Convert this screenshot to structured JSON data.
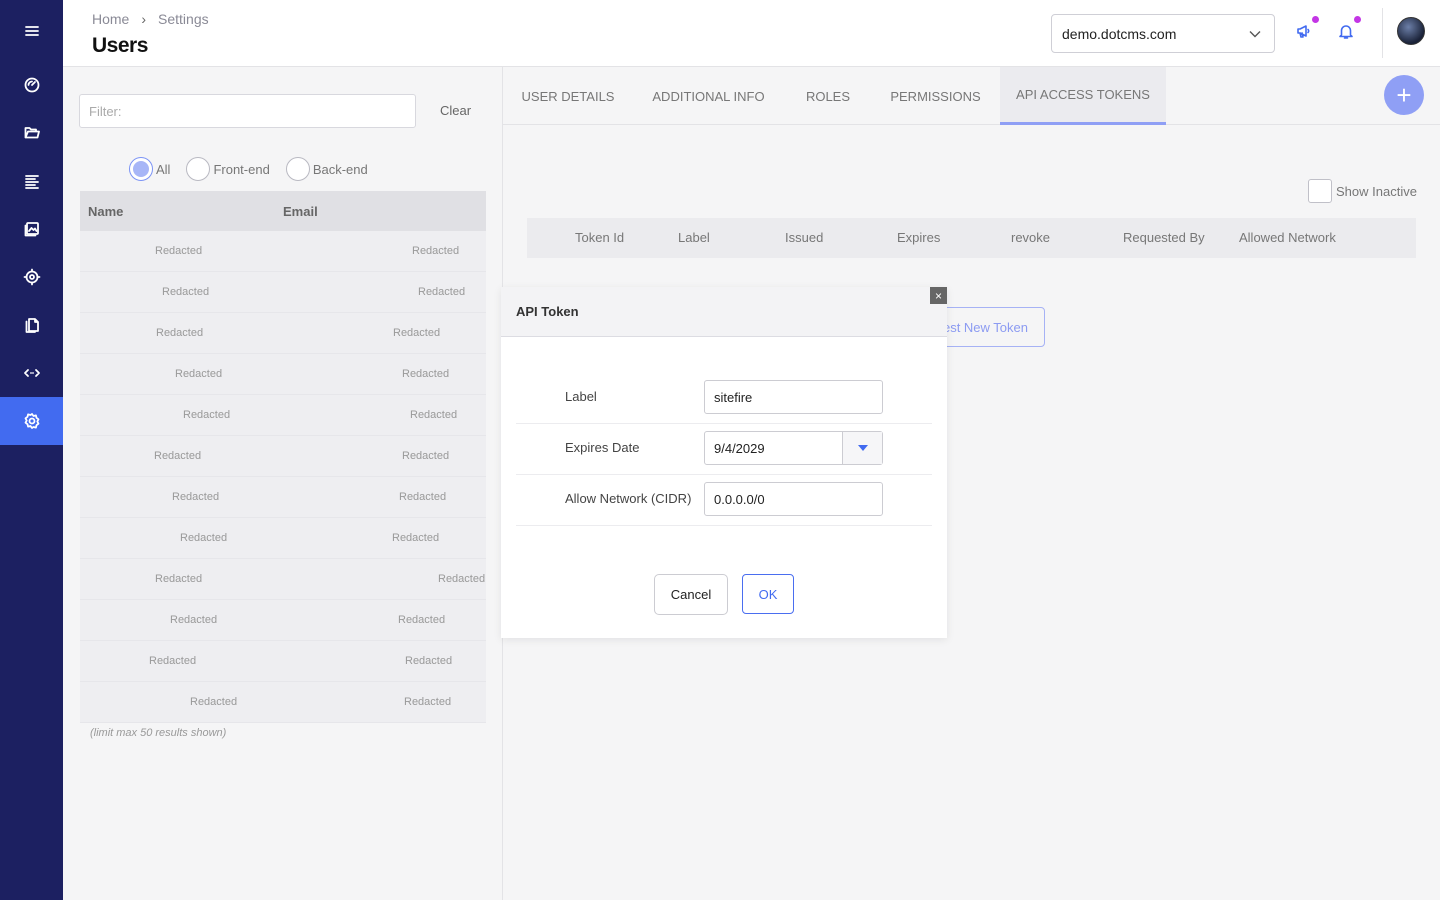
{
  "sidebar": {
    "items": [
      {
        "name": "menu-icon"
      },
      {
        "name": "dashboard-icon"
      },
      {
        "name": "folder-icon"
      },
      {
        "name": "content-icon"
      },
      {
        "name": "media-icon"
      },
      {
        "name": "marketing-icon"
      },
      {
        "name": "documents-icon"
      },
      {
        "name": "dev-tools-icon"
      },
      {
        "name": "settings-icon",
        "active": true
      }
    ]
  },
  "header": {
    "breadcrumb": {
      "home": "Home",
      "separator": "›",
      "current": "Settings"
    },
    "title": "Users",
    "site": "demo.dotcms.com"
  },
  "filter": {
    "placeholder": "Filter:",
    "clear_label": "Clear"
  },
  "radios": [
    {
      "label": "All",
      "checked": true
    },
    {
      "label": "Front-end",
      "checked": false
    },
    {
      "label": "Back-end",
      "checked": false
    }
  ],
  "user_table": {
    "columns": [
      "Name",
      "Email"
    ],
    "rows": [
      [
        "Redacted",
        "Redacted"
      ],
      [
        "Redacted",
        "Redacted"
      ],
      [
        "Redacted",
        "Redacted"
      ],
      [
        "Redacted",
        "Redacted"
      ],
      [
        "Redacted",
        "Redacted"
      ],
      [
        "Redacted",
        "Redacted"
      ],
      [
        "Redacted",
        "Redacted"
      ],
      [
        "Redacted",
        "Redacted"
      ],
      [
        "Redacted",
        "Redacted"
      ],
      [
        "Redacted",
        "Redacted"
      ],
      [
        "Redacted",
        "Redacted"
      ],
      [
        "Redacted",
        "Redacted"
      ]
    ],
    "note": "(limit max 50 results shown)"
  },
  "tabs": [
    {
      "label": "USER DETAILS"
    },
    {
      "label": "ADDITIONAL INFO"
    },
    {
      "label": "ROLES"
    },
    {
      "label": "PERMISSIONS"
    },
    {
      "label": "API ACCESS TOKENS",
      "active": true
    }
  ],
  "tokens": {
    "show_inactive": "Show Inactive",
    "columns": [
      "Token Id",
      "Label",
      "Issued",
      "Expires",
      "revoke",
      "Requested By",
      "Allowed Network"
    ],
    "request_label": "est New Token",
    "fab_label": "+"
  },
  "dialog": {
    "title": "API Token",
    "close_label": "×",
    "fields": {
      "label": {
        "label": "Label",
        "value": "sitefire"
      },
      "expires": {
        "label": "Expires Date",
        "value": "9/4/2029"
      },
      "network": {
        "label": "Allow Network (CIDR)",
        "value": "0.0.0.0/0"
      }
    },
    "cancel_label": "Cancel",
    "ok_label": "OK"
  },
  "colors": {
    "sidebar": "#1c2061",
    "accent": "#426bf0",
    "accent_light": "#8f9ff5",
    "notification_dot": "#c336e5"
  }
}
